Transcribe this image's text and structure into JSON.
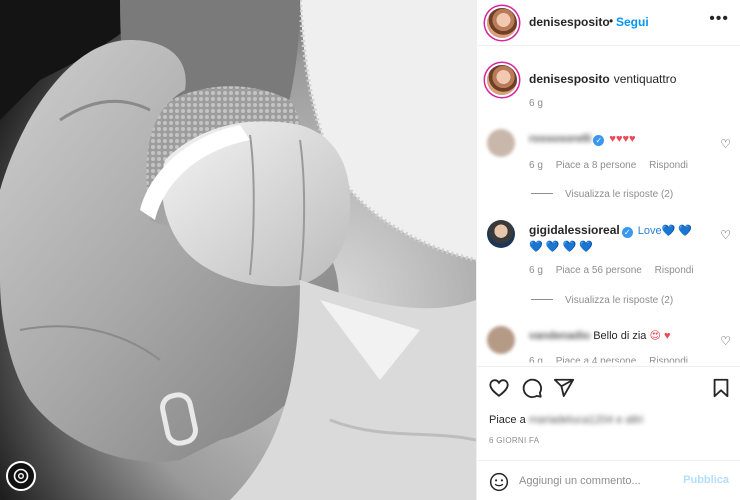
{
  "post": {
    "author": "denisesposito",
    "follow_label": "Segui",
    "separator": "•",
    "more_label": "•••"
  },
  "caption": {
    "author": "denisesposito",
    "text": "ventiquattro",
    "time": "6 g"
  },
  "comments": [
    {
      "username": "rossosorelli",
      "verified": true,
      "text": "♥♥♥♥",
      "time": "6 g",
      "likes": "Piace a 8 persone",
      "reply": "Rispondi",
      "view_replies": "Visualizza le risposte (2)"
    },
    {
      "username": "gigidalessioreal",
      "verified": true,
      "text": "Love💙 💙 💙 💙 💙 💙",
      "time": "6 g",
      "likes": "Piace a 56 persone",
      "reply": "Rispondi",
      "view_replies": "Visualizza le risposte (2)"
    },
    {
      "username": "vandenadio",
      "text_prefix": "Bello di zia",
      "emoji": "😍 ♥",
      "time": "6 g",
      "likes": "Piace a 4 persone",
      "reply": "Rispondi"
    }
  ],
  "likes_line": {
    "prefix": "Piace a",
    "users": "mariadeluca1204 e altri"
  },
  "date": "6 GIORNI FA",
  "compose": {
    "placeholder": "Aggiungi un commento...",
    "publish_label": "Pubblica"
  },
  "colors": {
    "accent_blue": "#0095f6",
    "heart_red": "#ed4956",
    "publish_disabled": "#b2dffc",
    "verified_blue": "#3897f0"
  },
  "icons": [
    "heart-icon",
    "comment-icon",
    "share-icon",
    "bookmark-icon",
    "emoji-icon",
    "threads-icon"
  ]
}
